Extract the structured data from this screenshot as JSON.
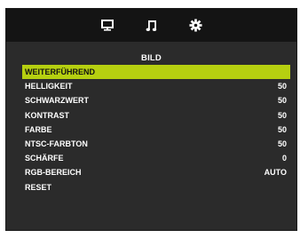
{
  "tabs": [
    {
      "icon": "monitor-icon",
      "active": true
    },
    {
      "icon": "music-note-icon",
      "active": false
    },
    {
      "icon": "gear-icon",
      "active": false
    }
  ],
  "section_title": "BILD",
  "colors": {
    "highlight": "#b6d010",
    "background": "#2b2b2b",
    "topbar": "#141414",
    "text": "#ffffff"
  },
  "menu": [
    {
      "label": "WEITERFÜHREND",
      "value": ""
    },
    {
      "label": "HELLIGKEIT",
      "value": "50"
    },
    {
      "label": "SCHWARZWERT",
      "value": "50"
    },
    {
      "label": "KONTRAST",
      "value": "50"
    },
    {
      "label": "FARBE",
      "value": "50"
    },
    {
      "label": "NTSC-FARBTON",
      "value": "50"
    },
    {
      "label": "SCHÄRFE",
      "value": "0"
    },
    {
      "label": "RGB-BEREICH",
      "value": "AUTO"
    },
    {
      "label": "RESET",
      "value": ""
    }
  ]
}
